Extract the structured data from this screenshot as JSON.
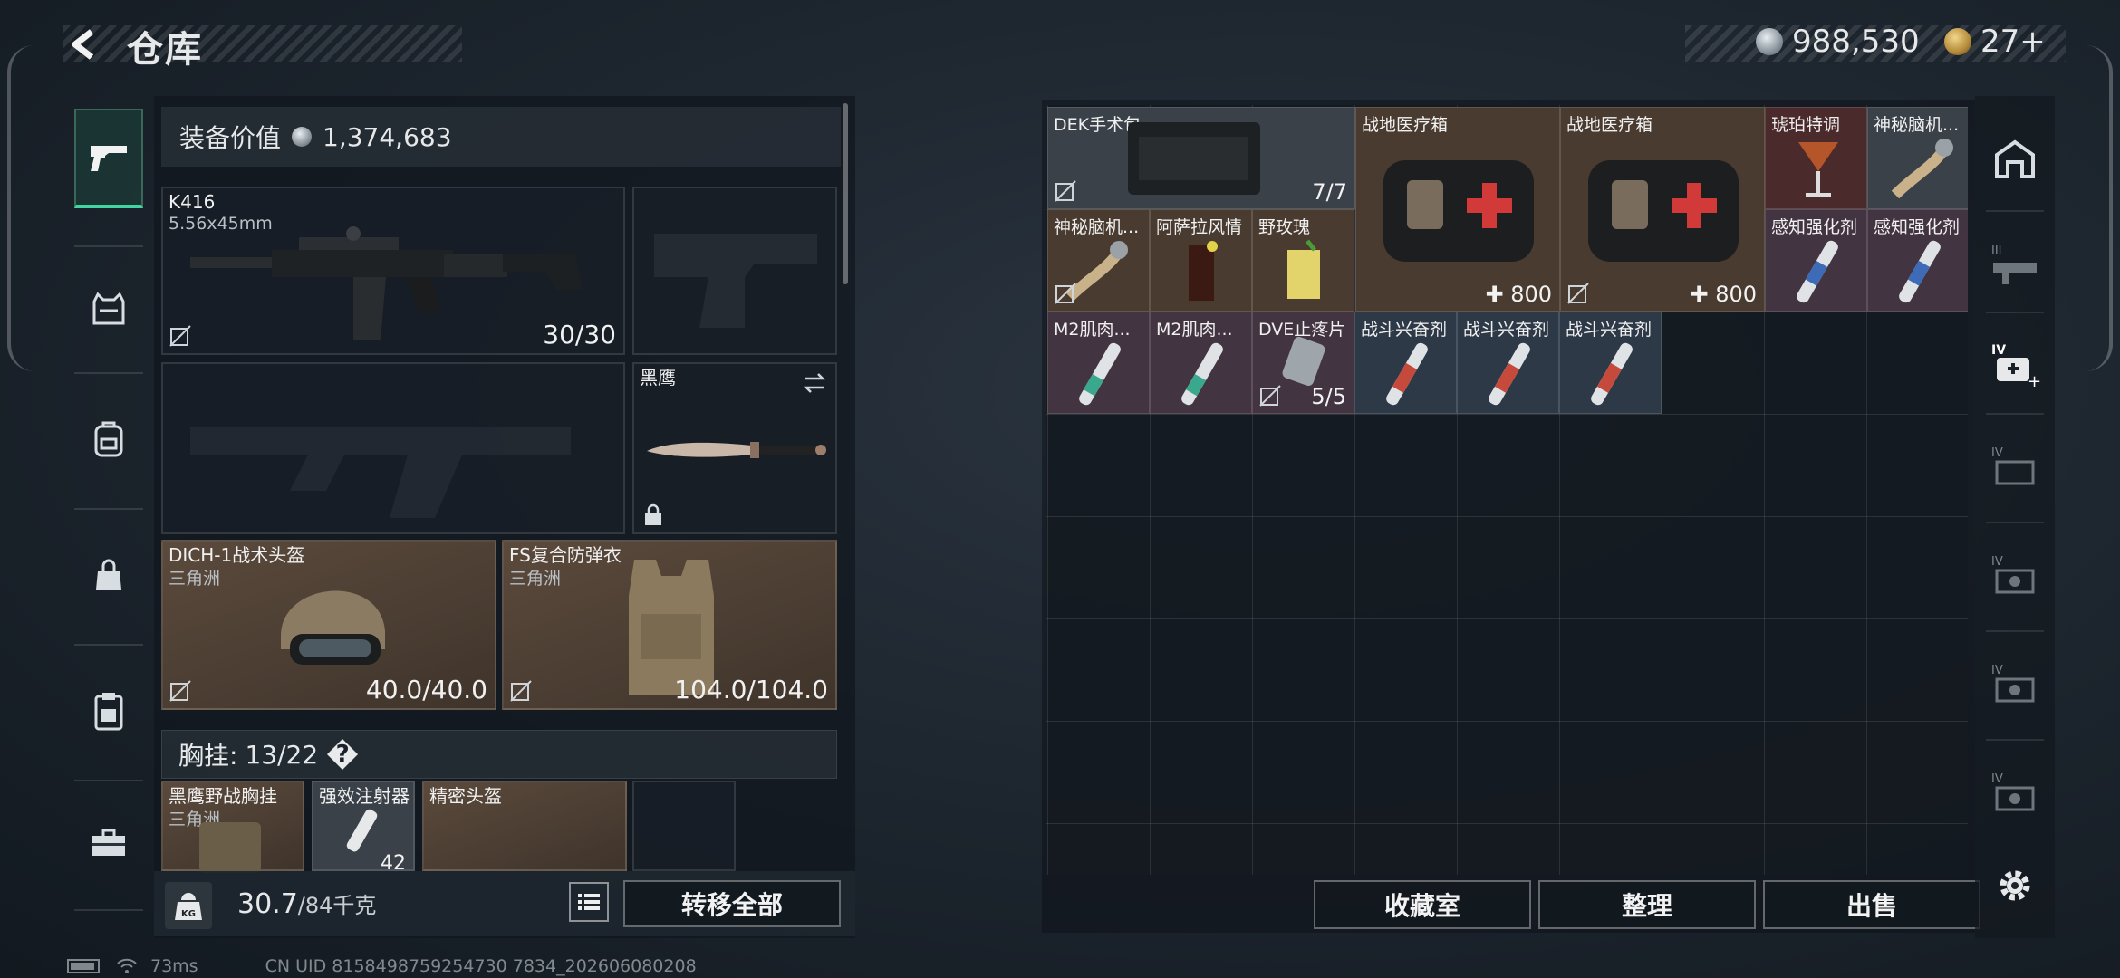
{
  "header": {
    "title": "仓库",
    "currencies": [
      {
        "icon": "silver-coin-icon",
        "value": "988,530"
      },
      {
        "icon": "gold-coin-icon",
        "value": "27+"
      }
    ]
  },
  "left_nav": {
    "items": [
      {
        "name": "weapon",
        "icon": "pistol-icon",
        "active": true
      },
      {
        "name": "armor",
        "icon": "vest-icon"
      },
      {
        "name": "backpack",
        "icon": "backpack-icon"
      },
      {
        "name": "bag",
        "icon": "bag-icon"
      },
      {
        "name": "clipboard",
        "icon": "clipboard-icon"
      },
      {
        "name": "toolbox",
        "icon": "toolbox-icon"
      }
    ]
  },
  "loadout": {
    "equip_value_label": "装备价值",
    "equip_value": "1,374,683",
    "primary": {
      "name": "K416",
      "caliber": "5.56x45mm",
      "ammo": "30/30"
    },
    "melee": {
      "name": "黑鹰"
    },
    "helmet": {
      "name": "DICH-1战术头盔",
      "brand": "三角洲",
      "durability": "40.0/40.0"
    },
    "armor": {
      "name": "FS复合防弹衣",
      "brand": "三角洲",
      "durability": "104.0/104.0"
    },
    "chest_rig": {
      "label": "胸挂:",
      "capacity": "13/22",
      "help": "?"
    },
    "rig_items": [
      {
        "name": "黑鹰野战胸挂",
        "brand": "三角洲"
      },
      {
        "name": "强效注射器",
        "value": "42"
      },
      {
        "name": "精密头盔"
      }
    ]
  },
  "footer": {
    "weight": "30.7",
    "weight_max": "/84千克",
    "weight_icon_text": "KG",
    "transfer_all": "转移全部"
  },
  "stash": {
    "items": [
      {
        "name": "DEK手术包",
        "value": "7/7"
      },
      {
        "name": "战地医疗箱",
        "value": "800"
      },
      {
        "name": "战地医疗箱",
        "value": "800"
      },
      {
        "name": "琥珀特调"
      },
      {
        "name": "神秘脑机..."
      },
      {
        "name": "神秘脑机..."
      },
      {
        "name": "阿萨拉风情"
      },
      {
        "name": "野玫瑰"
      },
      {
        "name": "感知强化剂"
      },
      {
        "name": "感知强化剂"
      },
      {
        "name": "M2肌肉..."
      },
      {
        "name": "M2肌肉..."
      },
      {
        "name": "DVE止疼片",
        "value": "5/5"
      },
      {
        "name": "战斗兴奋剂"
      },
      {
        "name": "战斗兴奋剂"
      },
      {
        "name": "战斗兴奋剂"
      }
    ]
  },
  "actions": {
    "collection": "收藏室",
    "organize": "整理",
    "sell": "出售"
  },
  "right_rail": {
    "tabs": [
      "stash-tab-icon",
      "weapons-tab-III-icon",
      "medical-tab-IV-icon",
      "tab-IV-a-icon",
      "tab-IV-b-icon",
      "tab-IV-c-icon",
      "tab-IV-d-icon"
    ]
  },
  "status": {
    "ping": "73ms",
    "uid": "CN UID 8158498759254730 7834_202606080208"
  }
}
